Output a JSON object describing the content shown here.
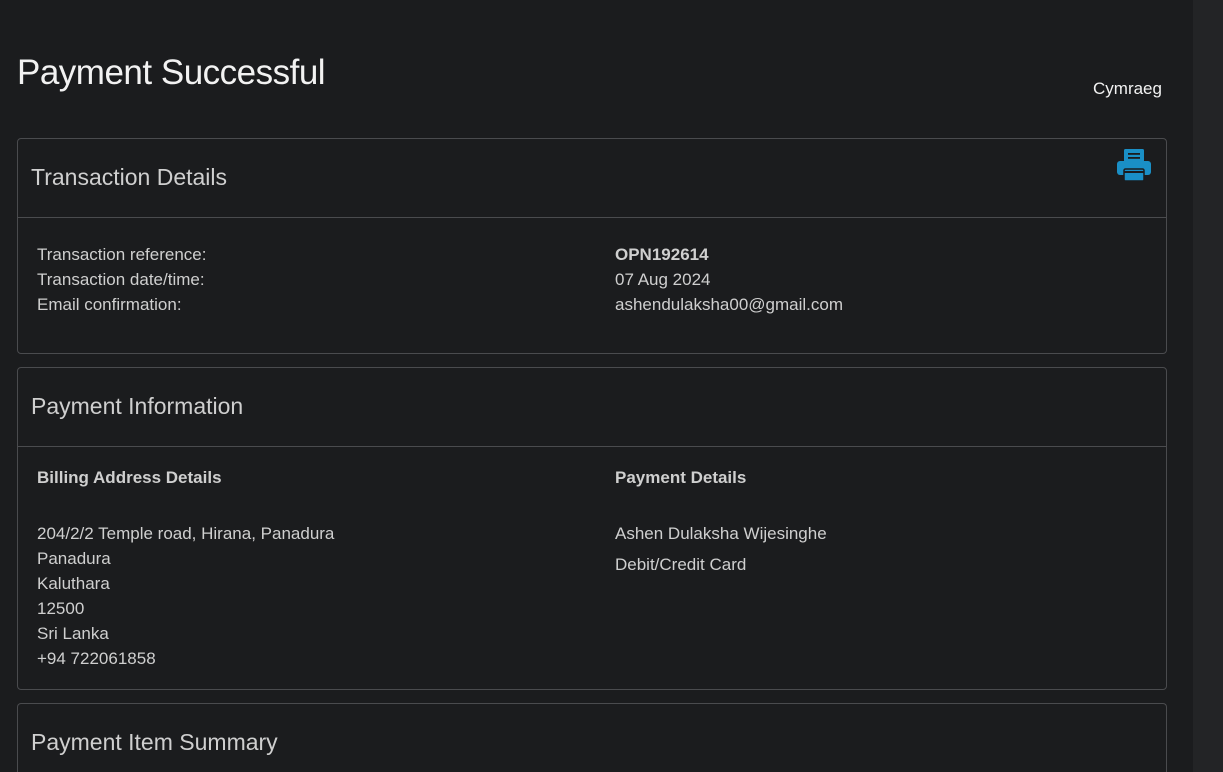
{
  "header": {
    "title": "Payment Successful",
    "language_link": "Cymraeg"
  },
  "transaction": {
    "heading": "Transaction Details",
    "print_icon": "printer-icon",
    "labels": {
      "reference": "Transaction reference:",
      "datetime": "Transaction date/time:",
      "email": "Email confirmation:"
    },
    "values": {
      "reference": "OPN192614",
      "datetime": "07 Aug 2024",
      "email": "ashendulaksha00@gmail.com"
    }
  },
  "payment_info": {
    "heading": "Payment Information",
    "billing": {
      "title": "Billing Address Details",
      "lines": [
        "204/2/2 Temple road, Hirana, Panadura",
        "Panadura",
        "Kaluthara",
        "12500",
        "Sri Lanka",
        "+94  722061858"
      ]
    },
    "payment": {
      "title": "Payment Details",
      "name": "Ashen Dulaksha Wijesinghe",
      "method": "Debit/Credit Card"
    }
  },
  "summary": {
    "heading": "Payment Item Summary"
  },
  "colors": {
    "background": "#1b1c1e",
    "accent": "#1a8fc6",
    "border": "#4a4b4e"
  }
}
